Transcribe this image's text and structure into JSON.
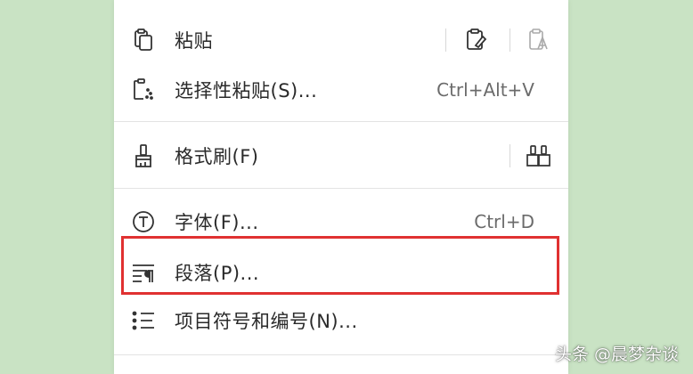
{
  "menu": {
    "items": [
      {
        "label": "粘贴",
        "shortcut": "",
        "icon": "clipboard-icon"
      },
      {
        "label": "选择性粘贴(S)...",
        "shortcut": "Ctrl+Alt+V",
        "icon": "paste-special-icon"
      },
      {
        "label": "格式刷(F)",
        "shortcut": "",
        "icon": "format-painter-icon"
      },
      {
        "label": "字体(F)...",
        "shortcut": "Ctrl+D",
        "icon": "font-icon"
      },
      {
        "label": "段落(P)...",
        "shortcut": "",
        "icon": "paragraph-icon"
      },
      {
        "label": "项目符号和编号(N)...",
        "shortcut": "",
        "icon": "bullet-list-icon"
      }
    ]
  },
  "watermark": "头条 @晨梦杂谈",
  "colors": {
    "background": "#c9e3c4",
    "menu": "#ffffff",
    "highlight": "#e03131"
  }
}
